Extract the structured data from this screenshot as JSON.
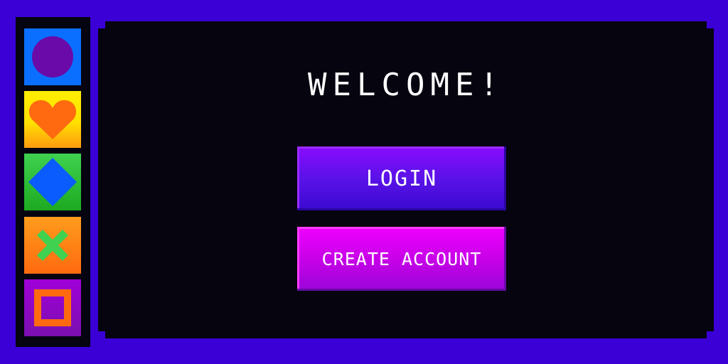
{
  "sidebar": {
    "items": [
      {
        "icon": "circle-icon",
        "color": "#0a6fff",
        "glyph_color": "#6a0aa8"
      },
      {
        "icon": "heart-icon",
        "color": "#ffe100",
        "glyph_color": "#ff6a10"
      },
      {
        "icon": "diamond-icon",
        "color": "#1daa21",
        "glyph_color": "#0a5cff"
      },
      {
        "icon": "cross-icon",
        "color": "#ff7a10",
        "glyph_color": "#3fd14f"
      },
      {
        "icon": "square-icon",
        "color": "#8a06c0",
        "glyph_color": "#ff6a10"
      }
    ]
  },
  "main": {
    "title": "WELCOME!",
    "login_label": "LOGIN",
    "create_account_label": "CREATE ACCOUNT"
  },
  "colors": {
    "background": "#3a00d6",
    "panel": "#05040f",
    "login_button": "#5a12e8",
    "create_button": "#c800e8",
    "text": "#ffffff"
  }
}
